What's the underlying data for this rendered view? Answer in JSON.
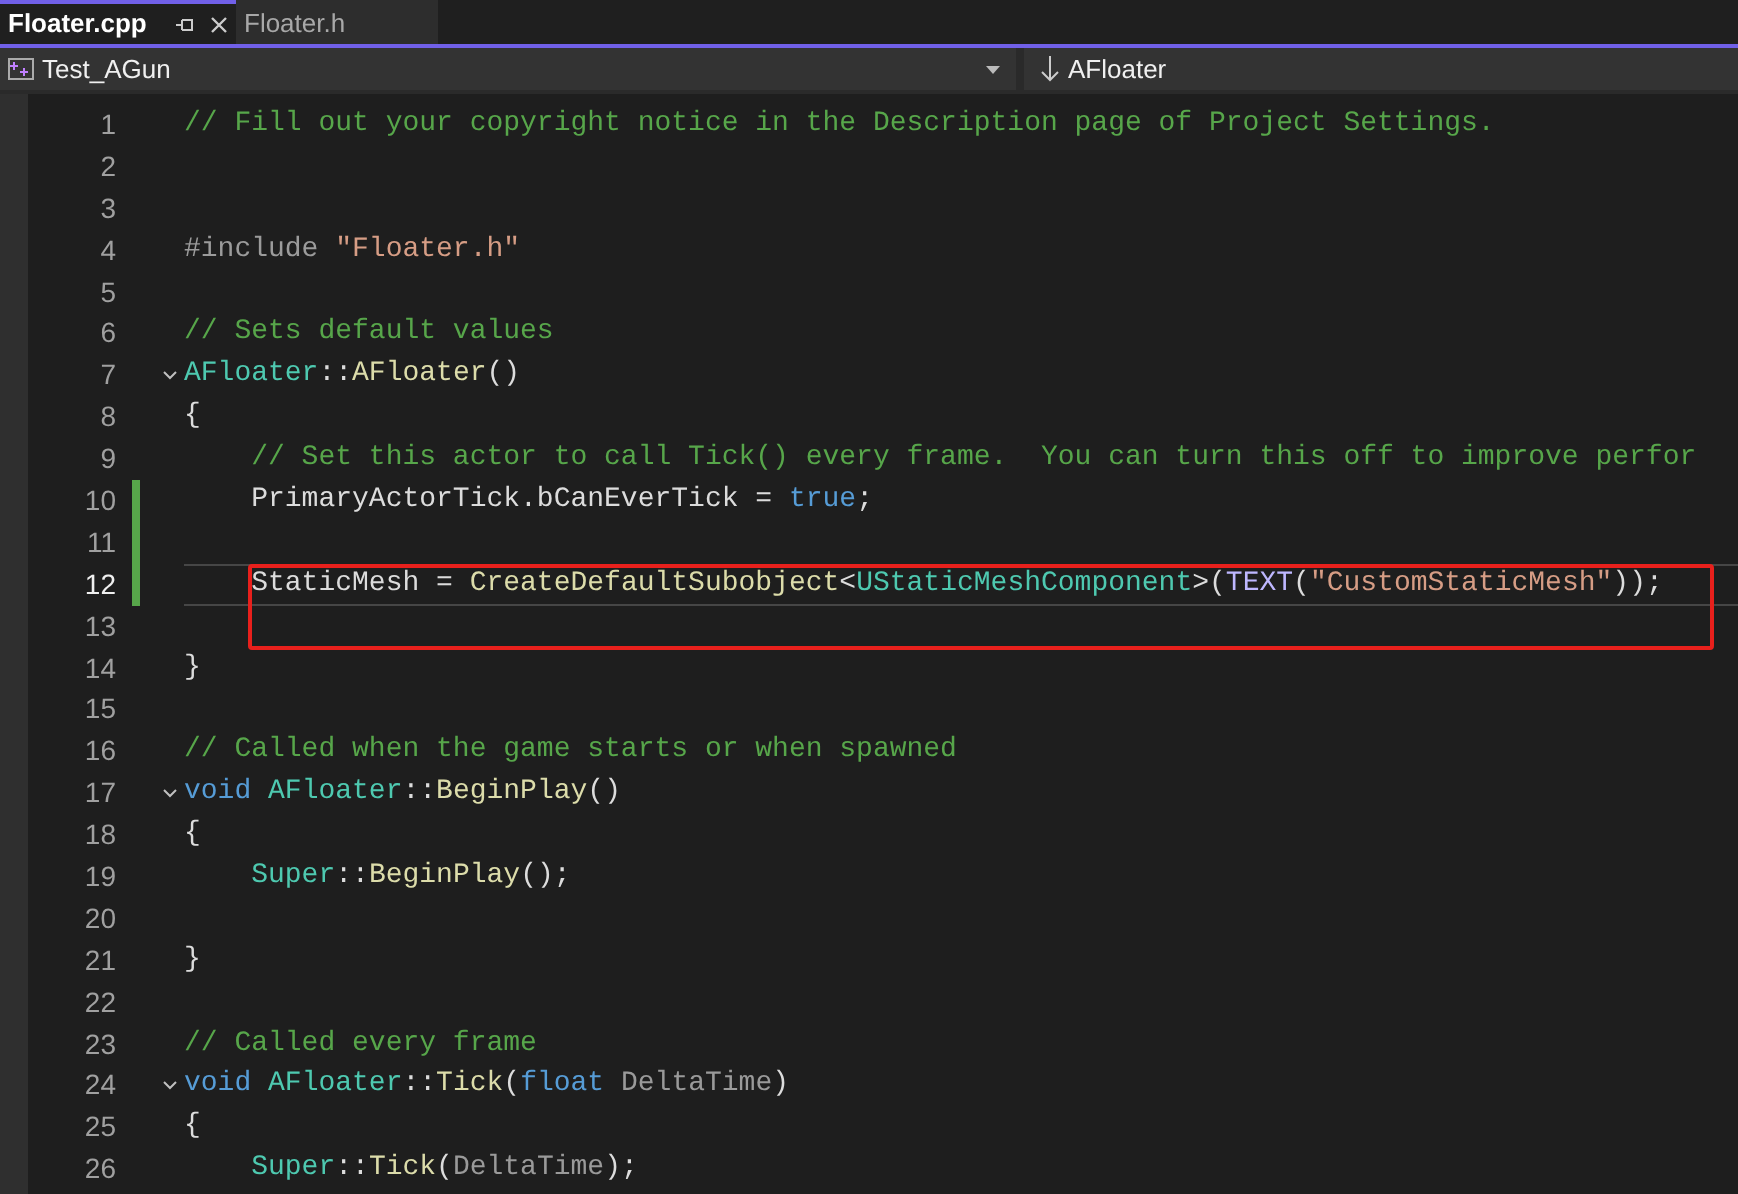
{
  "tabs": [
    {
      "label": "Floater.cpp",
      "selected": true
    },
    {
      "label": "Floater.h",
      "selected": false
    }
  ],
  "navigation": {
    "project": "Test_AGun",
    "scope": "AFloater"
  },
  "lines": [
    {
      "number": "1",
      "tokens": [
        {
          "kind": "comment",
          "text": "// Fill out your copyright notice in the Description page of Project Settings."
        }
      ]
    },
    {
      "number": "2"
    },
    {
      "number": "3"
    },
    {
      "number": "4",
      "tokens": [
        {
          "kind": "preproc",
          "text": "#include "
        },
        {
          "kind": "string",
          "text": "\"Floater.h\""
        }
      ]
    },
    {
      "number": "5"
    },
    {
      "number": "6",
      "tokens": [
        {
          "kind": "comment",
          "text": "// Sets default values"
        }
      ]
    },
    {
      "number": "7",
      "fold": true,
      "tokens": [
        {
          "kind": "type",
          "text": "AFloater"
        },
        {
          "kind": "plain",
          "text": "::"
        },
        {
          "kind": "function",
          "text": "AFloater"
        },
        {
          "kind": "plain",
          "text": "()"
        }
      ]
    },
    {
      "number": "8",
      "tokens": [
        {
          "kind": "plain",
          "text": "{"
        }
      ]
    },
    {
      "number": "9",
      "tokens": [
        {
          "kind": "comment",
          "text": "    // Set this actor to call Tick() every frame.  You can turn this off to improve perfor"
        }
      ]
    },
    {
      "number": "10",
      "changed": true,
      "tokens": [
        {
          "kind": "plain",
          "text": "    PrimaryActorTick.bCanEverTick = "
        },
        {
          "kind": "keyword",
          "text": "true"
        },
        {
          "kind": "plain",
          "text": ";"
        }
      ]
    },
    {
      "number": "11",
      "changed": true
    },
    {
      "number": "12",
      "changed": true,
      "current": true,
      "boxed": true,
      "tokens": [
        {
          "kind": "plain",
          "text": "    StaticMesh = "
        },
        {
          "kind": "function",
          "text": "CreateDefaultSubobject"
        },
        {
          "kind": "plain",
          "text": "<"
        },
        {
          "kind": "type",
          "text": "UStaticMeshComponent"
        },
        {
          "kind": "plain",
          "text": ">("
        },
        {
          "kind": "macro",
          "text": "TEXT"
        },
        {
          "kind": "plain",
          "text": "("
        },
        {
          "kind": "string",
          "text": "\"CustomStaticMesh\""
        },
        {
          "kind": "plain",
          "text": "));"
        }
      ]
    },
    {
      "number": "13",
      "boxed": true
    },
    {
      "number": "14",
      "tokens": [
        {
          "kind": "plain",
          "text": "}"
        }
      ]
    },
    {
      "number": "15"
    },
    {
      "number": "16",
      "tokens": [
        {
          "kind": "comment",
          "text": "// Called when the game starts or when spawned"
        }
      ]
    },
    {
      "number": "17",
      "fold": true,
      "tokens": [
        {
          "kind": "keyword",
          "text": "void "
        },
        {
          "kind": "type",
          "text": "AFloater"
        },
        {
          "kind": "plain",
          "text": "::"
        },
        {
          "kind": "function",
          "text": "BeginPlay"
        },
        {
          "kind": "plain",
          "text": "()"
        }
      ]
    },
    {
      "number": "18",
      "tokens": [
        {
          "kind": "plain",
          "text": "{"
        }
      ]
    },
    {
      "number": "19",
      "tokens": [
        {
          "kind": "type",
          "text": "    Super"
        },
        {
          "kind": "plain",
          "text": "::"
        },
        {
          "kind": "function",
          "text": "BeginPlay"
        },
        {
          "kind": "plain",
          "text": "();"
        }
      ]
    },
    {
      "number": "20"
    },
    {
      "number": "21",
      "tokens": [
        {
          "kind": "plain",
          "text": "}"
        }
      ]
    },
    {
      "number": "22"
    },
    {
      "number": "23",
      "tokens": [
        {
          "kind": "comment",
          "text": "// Called every frame"
        }
      ]
    },
    {
      "number": "24",
      "fold": true,
      "tokens": [
        {
          "kind": "keyword",
          "text": "void "
        },
        {
          "kind": "type",
          "text": "AFloater"
        },
        {
          "kind": "plain",
          "text": "::"
        },
        {
          "kind": "function",
          "text": "Tick"
        },
        {
          "kind": "plain",
          "text": "("
        },
        {
          "kind": "keyword",
          "text": "float "
        },
        {
          "kind": "param",
          "text": "DeltaTime"
        },
        {
          "kind": "plain",
          "text": ")"
        }
      ]
    },
    {
      "number": "25",
      "tokens": [
        {
          "kind": "plain",
          "text": "{"
        }
      ]
    },
    {
      "number": "26",
      "tokens": [
        {
          "kind": "type",
          "text": "    Super"
        },
        {
          "kind": "plain",
          "text": "::"
        },
        {
          "kind": "function",
          "text": "Tick"
        },
        {
          "kind": "plain",
          "text": "("
        },
        {
          "kind": "param",
          "text": "DeltaTime"
        },
        {
          "kind": "plain",
          "text": ");"
        }
      ]
    }
  ]
}
